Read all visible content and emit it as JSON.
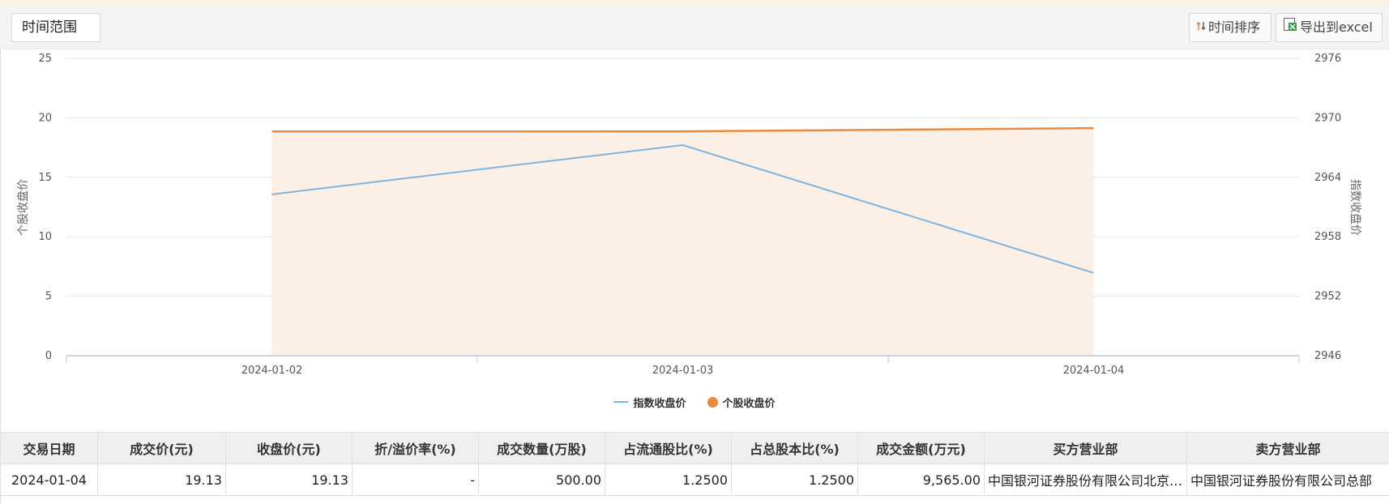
{
  "toolbar": {
    "range_label": "时间范围",
    "sort_label": "时间排序",
    "export_label": "导出到excel"
  },
  "chart_data": {
    "type": "line",
    "x": [
      "2024-01-02",
      "2024-01-03",
      "2024-01-04"
    ],
    "series": [
      {
        "name": "指数收盘价",
        "axis": "right",
        "color": "#7eb4e0",
        "values": [
          2962.28,
          2967.25,
          2954.35
        ]
      },
      {
        "name": "个股收盘价",
        "axis": "left",
        "color": "#ec8a3c",
        "area_color": "#fcefe5",
        "values": [
          18.85,
          18.86,
          19.13
        ]
      }
    ],
    "ylabel": "个股收盘价",
    "ylabel_right": "指数收盘价",
    "ylim": [
      0,
      25
    ],
    "ylim_right": [
      2946,
      2976
    ],
    "yticks": [
      0,
      5,
      10,
      15,
      20,
      25
    ],
    "yticks_right": [
      2946,
      2952,
      2958,
      2964,
      2970,
      2976
    ],
    "grid": true,
    "legend_position": "bottom-center"
  },
  "table": {
    "headers": [
      "交易日期",
      "成交价(元)",
      "收盘价(元)",
      "折/溢价率(%)",
      "成交数量(万股)",
      "占流通股比(%)",
      "占总股本比(%)",
      "成交金额(万元)",
      "买方营业部",
      "卖方营业部"
    ],
    "rows": [
      [
        "2024-01-04",
        "19.13",
        "19.13",
        "-",
        "500.00",
        "1.2500",
        "1.2500",
        "9,565.00",
        "中国银河证券股份有限公司北京中关村大街证券营业部",
        "中国银河证券股份有限公司总部"
      ]
    ]
  }
}
